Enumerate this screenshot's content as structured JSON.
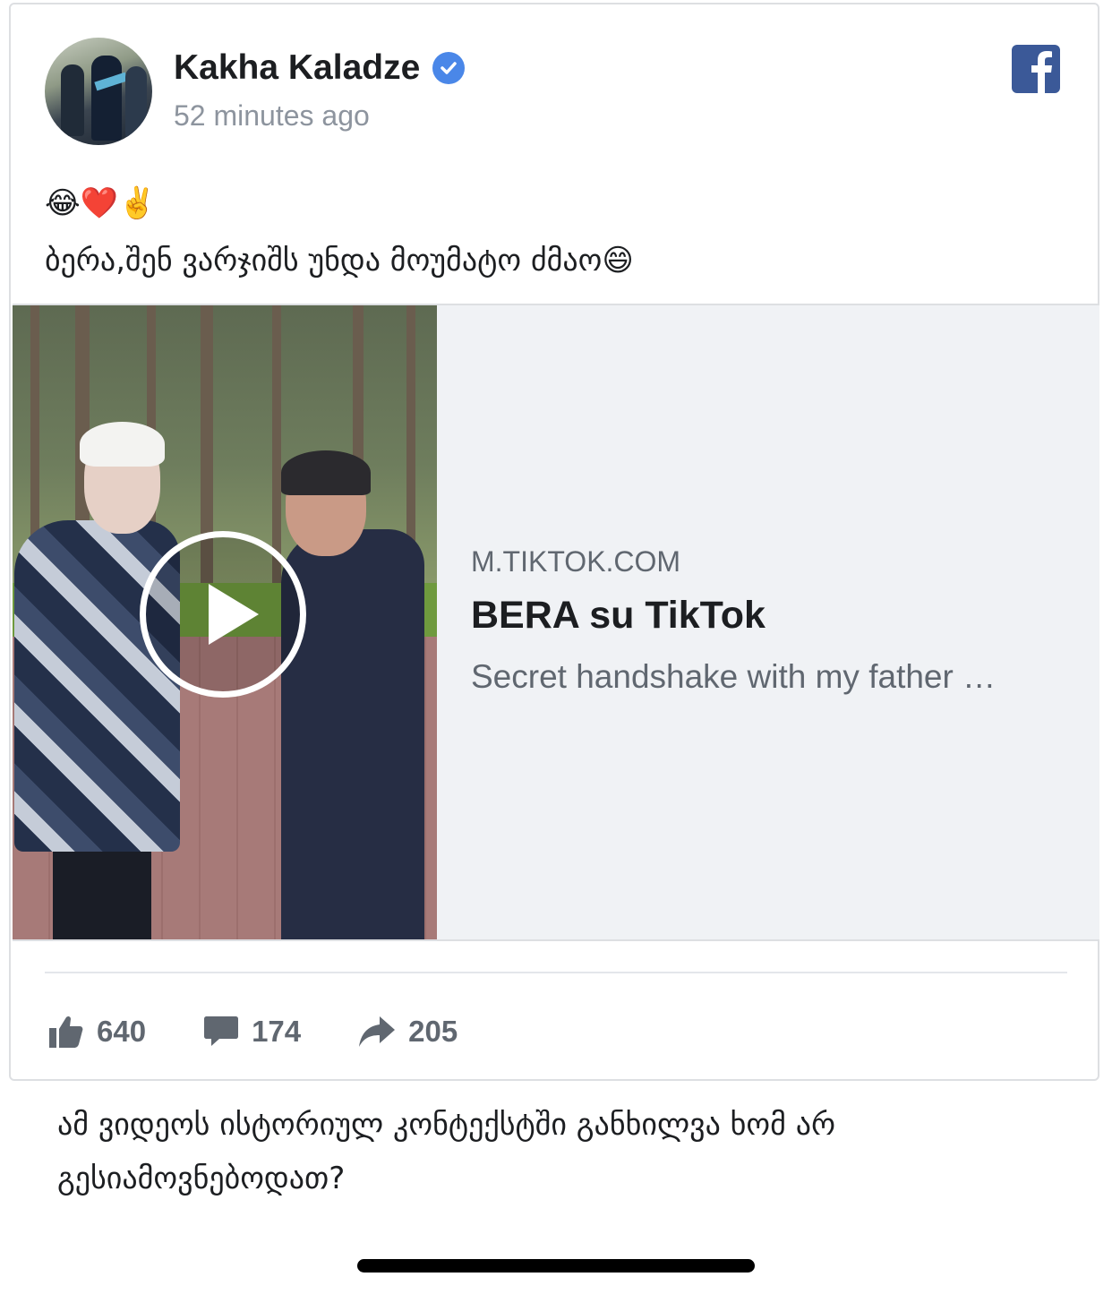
{
  "post": {
    "author": "Kakha Kaladze",
    "timestamp": "52 minutes ago",
    "verified_icon": "verified-badge-icon",
    "platform_icon": "facebook-logo-icon",
    "text_line1": "😂❤️✌️",
    "text_line2": "ბერა,შენ ვარჯიშს უნდა მოუმატო ძმაო😄"
  },
  "link": {
    "domain": "M.TIKTOK.COM",
    "title": "BERA su TikTok",
    "description": "Secret handshake with my father …",
    "thumbnail_icon": "play-button-icon"
  },
  "stats": {
    "likes": "640",
    "comments": "174",
    "shares": "205"
  },
  "caption": "ამ ვიდეოს ისტორიულ კონტექსტში განხილვა ხომ არ გესიამოვნებოდათ?",
  "colors": {
    "facebook_blue": "#3b5998",
    "verified_blue": "#4a87e8",
    "muted_text": "#606770"
  }
}
